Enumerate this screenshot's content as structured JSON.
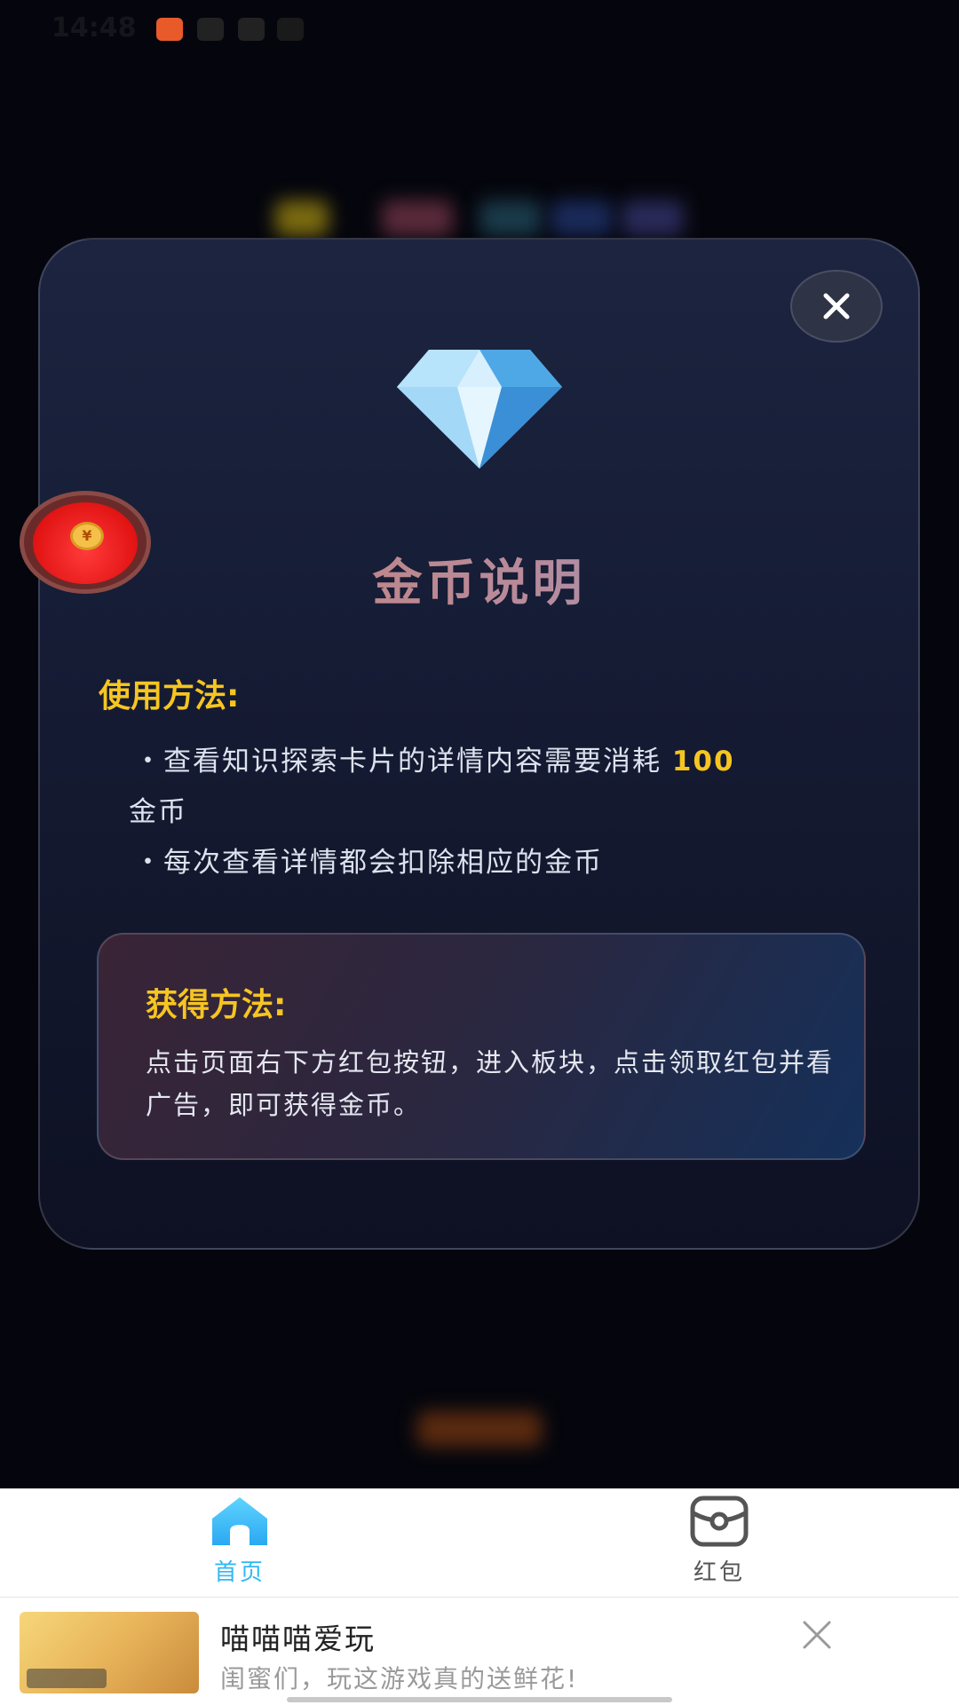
{
  "status_bar": {
    "time": "14:48"
  },
  "modal": {
    "title": "金币说明",
    "usage_heading": "使用方法:",
    "usage_item1_prefix": "・查看知识探索卡片的详情内容需要消耗 ",
    "usage_item1_amount": "100",
    "usage_item1_suffix": "金币",
    "usage_item2": "・每次查看详情都会扣除相应的金币",
    "obtain_heading": "获得方法:",
    "obtain_text": "点击页面右下方红包按钮，进入板块，点击领取红包并看广告，即可获得金币。",
    "close_icon": "close-icon",
    "accent_color": "#f6c520"
  },
  "floating": {
    "redpacket_symbol": "¥"
  },
  "bottom_nav": {
    "items": [
      {
        "label": "首页",
        "icon": "home-icon",
        "active": true,
        "color": "#30b8f5"
      },
      {
        "label": "红包",
        "icon": "red-packet-icon",
        "active": false,
        "color": "#555555"
      }
    ]
  },
  "ad": {
    "title": "喵喵喵爱玩",
    "subtitle": "闺蜜们，玩这游戏真的送鲜花!",
    "close_icon": "close-icon"
  }
}
